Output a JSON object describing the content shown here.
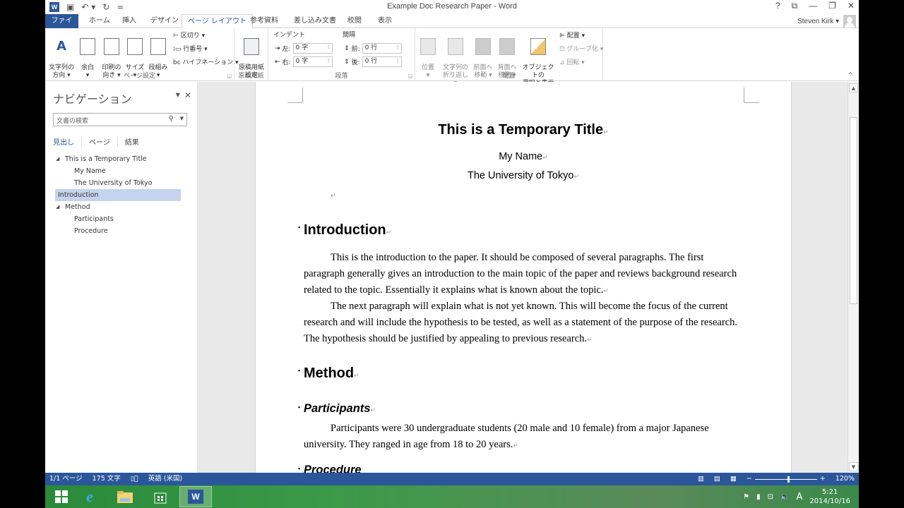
{
  "window": {
    "title": "Example Doc Research Paper - Word",
    "controls": {
      "help": "?",
      "ribbon_display": "⧉",
      "minimize": "—",
      "restore": "❐",
      "close": "✕"
    }
  },
  "qat": {
    "save": "💾",
    "undo": "↶ ▾",
    "redo": "↻",
    "customize": "="
  },
  "tabs": [
    {
      "label": "ファイル"
    },
    {
      "label": "ホーム"
    },
    {
      "label": "挿入"
    },
    {
      "label": "デザイン"
    },
    {
      "label": "ページ レイアウト",
      "active": true
    },
    {
      "label": "参考資料"
    },
    {
      "label": "差し込み文書"
    },
    {
      "label": "校閲"
    },
    {
      "label": "表示"
    }
  ],
  "user": {
    "name": "Steven Kirk ▾"
  },
  "ribbon": {
    "page_setup": {
      "label": "ページ設定",
      "text_direction": "文字列の\n方向 ▾",
      "margins": "余白\n▾",
      "orientation": "印刷の\n向き ▾",
      "size": "サイズ\n▾",
      "columns": "段組み\n▾",
      "breaks": "区切り ▾",
      "line_numbers": "行番号 ▾",
      "hyphenation": "ハイフネーション ▾"
    },
    "manuscript": {
      "label": "原稿用紙",
      "button": "原稿用紙\n設定"
    },
    "paragraph": {
      "label": "段落",
      "indent_label": "インデント",
      "spacing_label": "間隔",
      "left_label": "左:",
      "left_value": "0 字",
      "right_label": "右:",
      "right_value": "0 字",
      "before_label": "前:",
      "before_value": "0 行",
      "after_label": "後:",
      "after_value": "0 行"
    },
    "arrange": {
      "label": "配置",
      "position": "位置\n▾",
      "wrap_text": "文字列の\n折り返し ▾",
      "bring_forward": "前面へ\n移動 ▾",
      "send_backward": "背面へ\n移動 ▾",
      "selection_pane": "オブジェクトの\n選択と表示",
      "align": "配置 ▾",
      "group": "グループ化 ▾",
      "rotate": "回転 ▾"
    }
  },
  "nav": {
    "title": "ナビゲーション",
    "search_placeholder": "文書の検索",
    "tabs": [
      "見出し",
      "ページ",
      "結果"
    ],
    "tree": [
      {
        "label": "This is a Temporary Title",
        "level": 1,
        "expanded": true
      },
      {
        "label": "My Name",
        "level": 2
      },
      {
        "label": "The University of Tokyo",
        "level": 2
      },
      {
        "label": "Introduction",
        "level": 1,
        "selected": true
      },
      {
        "label": "Method",
        "level": 1,
        "expanded": true
      },
      {
        "label": "Participants",
        "level": 2
      },
      {
        "label": "Procedure",
        "level": 2
      }
    ]
  },
  "document": {
    "title": "This is a Temporary Title",
    "author": "My Name",
    "affiliation": "The University of Tokyo",
    "pilcrow": "↵",
    "heading_intro": "Introduction",
    "intro_p1": "This is the introduction to the paper. It should be composed of several paragraphs. The first paragraph generally gives an introduction to the main topic of the paper and reviews background research related to the topic. Essentially it explains what is known about the topic.",
    "intro_p2": "The next paragraph will explain what is not yet known. This will become the focus of the current research and will include the hypothesis to be tested, as well as a statement of the purpose of the research. The hypothesis should be justified by appealing to previous research.",
    "heading_method": "Method",
    "heading_participants": "Participants",
    "participants_p": "Participants were 30 undergraduate students (20 male and 10 female) from a major Japanese university. They ranged in age from 18 to 20 years.",
    "heading_procedure": "Procedure"
  },
  "status": {
    "page": "1/1 ページ",
    "words": "175 文字",
    "proofing_icon": "📖",
    "language": "英語 (米国)",
    "zoom": "120%",
    "zoom_minus": "−",
    "zoom_plus": "+"
  },
  "taskbar": {
    "time": "5:21",
    "date": "2014/10/16",
    "ime": "A"
  }
}
